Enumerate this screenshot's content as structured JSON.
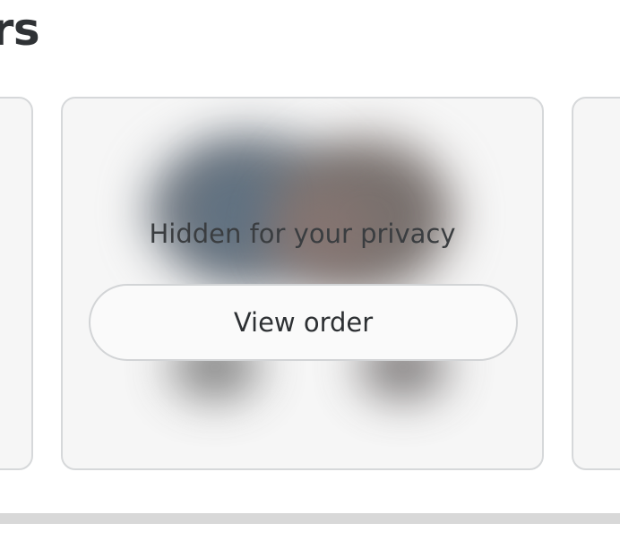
{
  "section": {
    "title": "ders"
  },
  "cards": [
    {
      "id": "prev",
      "privacy_text": null,
      "button_label": null
    },
    {
      "id": "main",
      "privacy_text": "Hidden for your privacy",
      "button_label": "View order"
    },
    {
      "id": "next",
      "privacy_text": null,
      "button_label": null
    }
  ],
  "colors": {
    "card_border": "#d6d8da",
    "card_background": "#f6f6f6",
    "title_text": "#2f3235",
    "button_border": "#d2d4d6",
    "scroll_track": "#d8d8d8"
  },
  "icons": {}
}
